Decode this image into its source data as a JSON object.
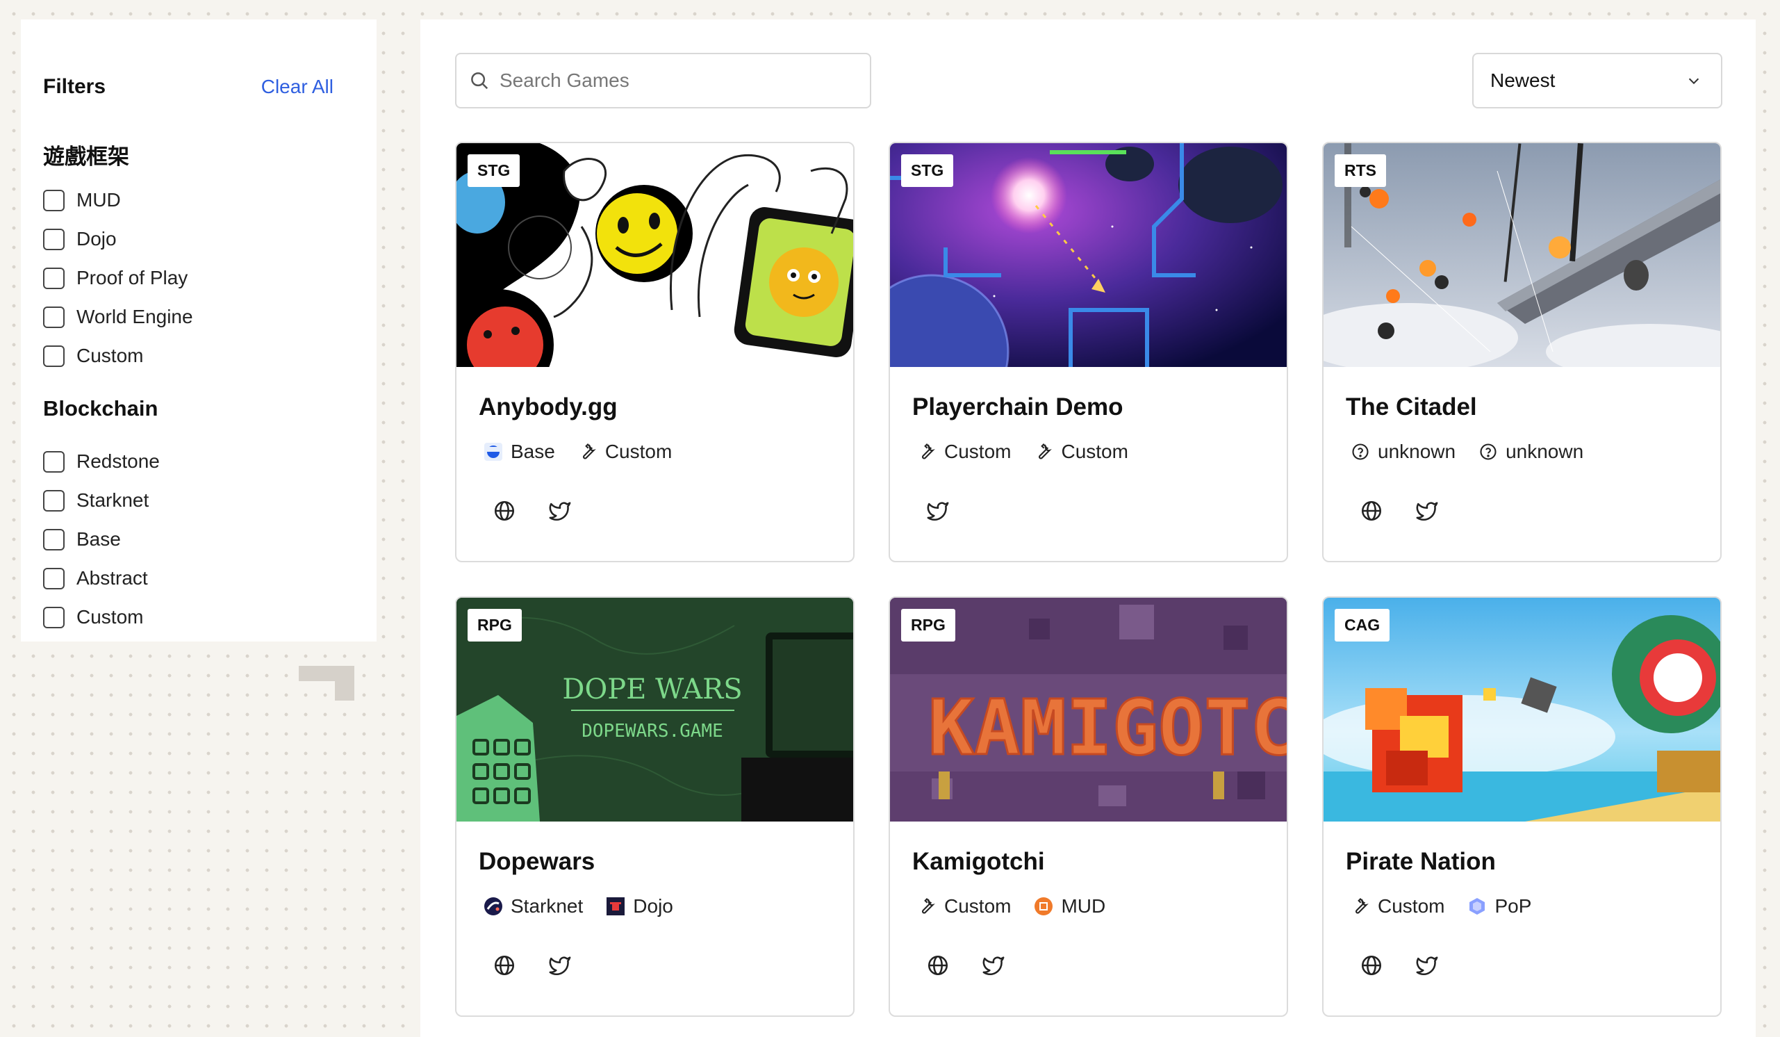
{
  "filters": {
    "title": "Filters",
    "clear_all": "Clear All",
    "framework": {
      "title": "遊戲框架",
      "options": [
        "MUD",
        "Dojo",
        "Proof of Play",
        "World Engine",
        "Custom"
      ]
    },
    "blockchain": {
      "title": "Blockchain",
      "options": [
        "Redstone",
        "Starknet",
        "Base",
        "Abstract",
        "Custom"
      ]
    }
  },
  "search": {
    "placeholder": "Search Games"
  },
  "sort": {
    "selected": "Newest"
  },
  "games": [
    {
      "genre": "STG",
      "title": "Anybody.gg",
      "tags": [
        {
          "icon": "base-logo-icon",
          "label": "Base"
        },
        {
          "icon": "wrench-icon",
          "label": "Custom"
        }
      ],
      "links": [
        "globe-icon",
        "twitter-icon"
      ]
    },
    {
      "genre": "STG",
      "title": "Playerchain Demo",
      "tags": [
        {
          "icon": "wrench-icon",
          "label": "Custom"
        },
        {
          "icon": "wrench-icon",
          "label": "Custom"
        }
      ],
      "links": [
        "twitter-icon"
      ]
    },
    {
      "genre": "RTS",
      "title": "The Citadel",
      "tags": [
        {
          "icon": "question-circle-icon",
          "label": "unknown"
        },
        {
          "icon": "question-circle-icon",
          "label": "unknown"
        }
      ],
      "links": [
        "globe-icon",
        "twitter-icon"
      ]
    },
    {
      "genre": "RPG",
      "title": "Dopewars",
      "tags": [
        {
          "icon": "starknet-logo-icon",
          "label": "Starknet"
        },
        {
          "icon": "dojo-logo-icon",
          "label": "Dojo"
        }
      ],
      "links": [
        "globe-icon",
        "twitter-icon"
      ],
      "thumb_text": [
        "DOPE WARS",
        "DOPEWARS.GAME"
      ]
    },
    {
      "genre": "RPG",
      "title": "Kamigotchi",
      "tags": [
        {
          "icon": "wrench-icon",
          "label": "Custom"
        },
        {
          "icon": "mud-logo-icon",
          "label": "MUD"
        }
      ],
      "links": [
        "globe-icon",
        "twitter-icon"
      ],
      "thumb_text": [
        "KAMIGOTCHI"
      ]
    },
    {
      "genre": "CAG",
      "title": "Pirate Nation",
      "tags": [
        {
          "icon": "wrench-icon",
          "label": "Custom"
        },
        {
          "icon": "pop-logo-icon",
          "label": "PoP"
        }
      ],
      "links": [
        "globe-icon",
        "twitter-icon"
      ]
    }
  ],
  "colors": {
    "accent": "#2f5fe0",
    "border": "#dcdcdc",
    "page_bg": "#f6f4ef"
  }
}
